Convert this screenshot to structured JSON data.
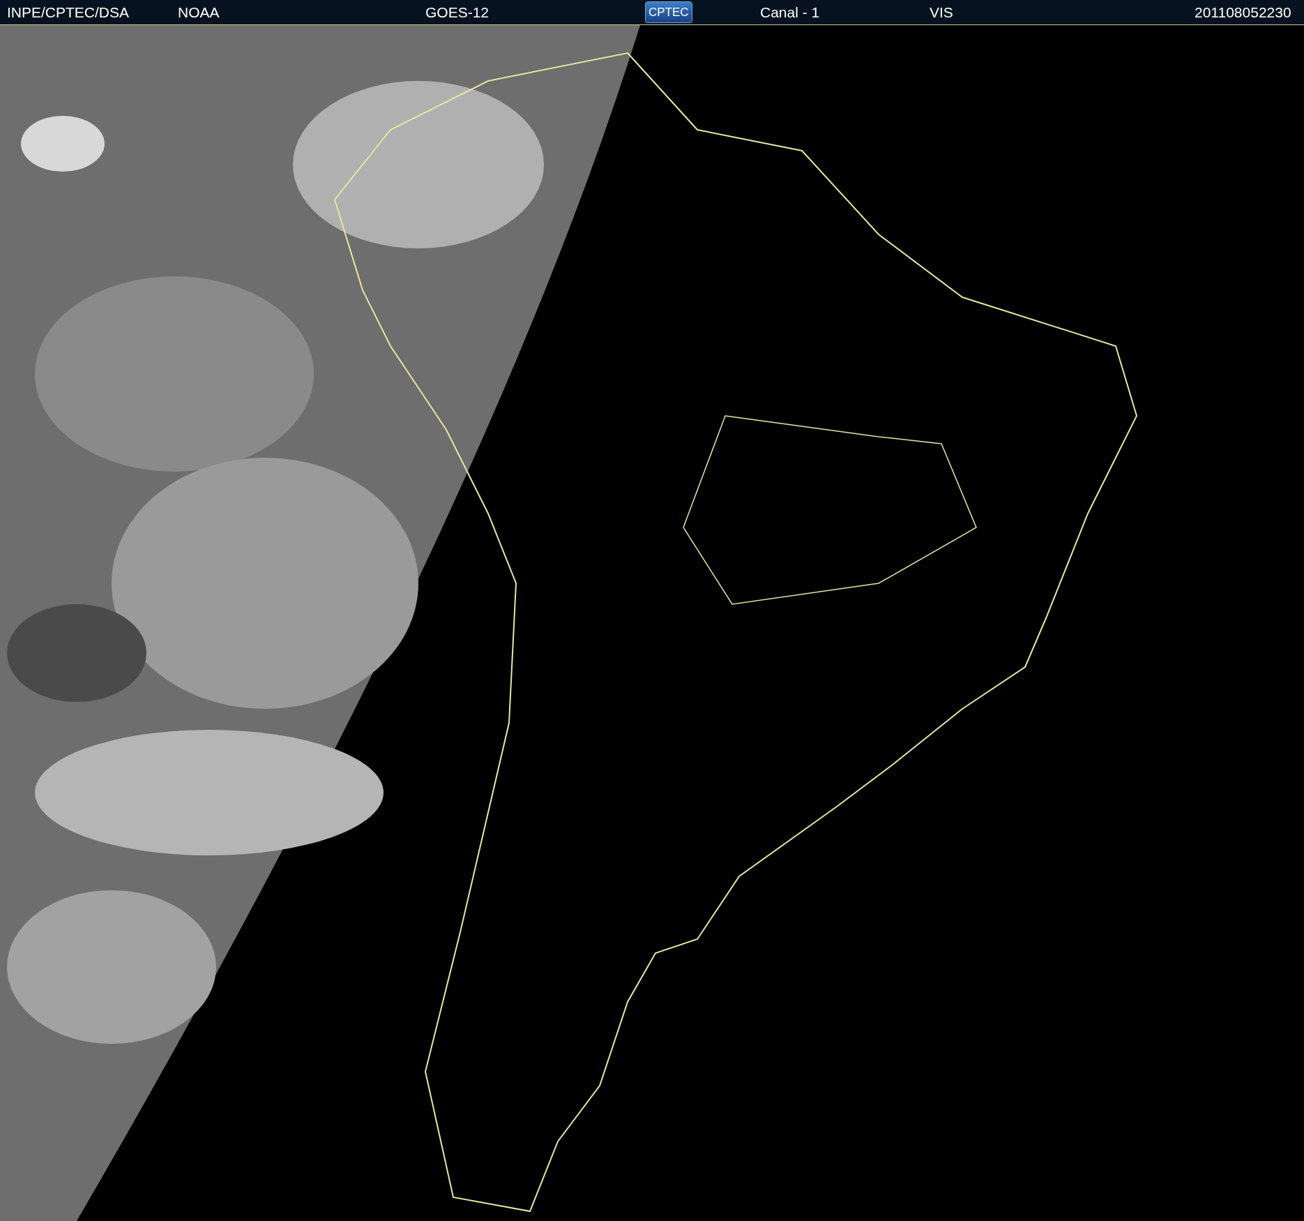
{
  "header": {
    "items": [
      {
        "kind": "text",
        "text": "INPE/CPTEC/DSA"
      },
      {
        "kind": "text",
        "text": "NOAA"
      },
      {
        "kind": "text",
        "text": "GOES-12"
      },
      {
        "kind": "logo",
        "text": "CPTEC"
      },
      {
        "kind": "text",
        "text": "Canal - 1"
      },
      {
        "kind": "text",
        "text": "VIS"
      },
      {
        "kind": "text",
        "text": "201108052230"
      }
    ]
  }
}
